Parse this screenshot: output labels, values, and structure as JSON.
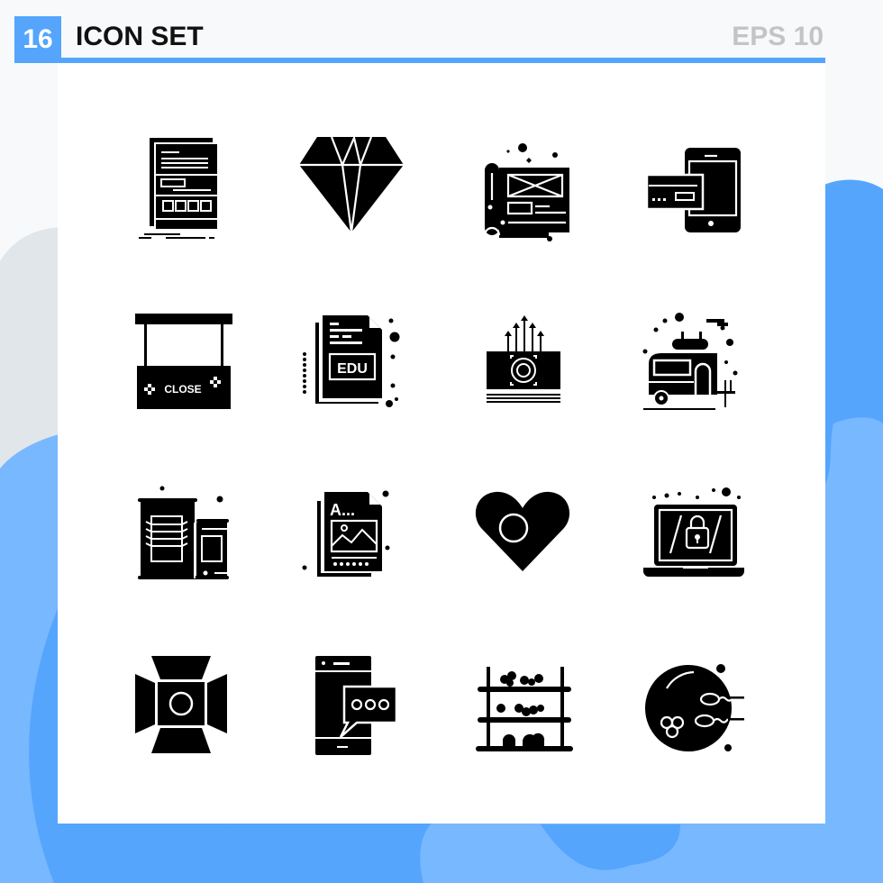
{
  "header": {
    "count": "16",
    "title": "ICON SET",
    "format": "EPS 10"
  },
  "colors": {
    "accent": "#55a5fd",
    "accent_light": "#78b8ff",
    "bg_gray": "#e1e6ea",
    "icon": "#000000",
    "eps_text": "#c4c4c4"
  },
  "icons": [
    {
      "name": "web-layout-document-icon"
    },
    {
      "name": "diamond-icon"
    },
    {
      "name": "blueprint-wireframe-icon"
    },
    {
      "name": "mobile-card-payment-icon"
    },
    {
      "name": "closed-sign-board-icon",
      "label": "CLOSE"
    },
    {
      "name": "edu-document-icon",
      "label": "EDU"
    },
    {
      "name": "money-growth-chart-icon"
    },
    {
      "name": "camper-trailer-icon"
    },
    {
      "name": "server-building-icon"
    },
    {
      "name": "image-file-document-icon",
      "label": "A..."
    },
    {
      "name": "heart-circle-icon"
    },
    {
      "name": "laptop-lock-icon"
    },
    {
      "name": "studio-light-icon"
    },
    {
      "name": "mobile-chat-icon"
    },
    {
      "name": "pharmacy-shelf-icon"
    },
    {
      "name": "fertilization-cell-icon"
    }
  ]
}
